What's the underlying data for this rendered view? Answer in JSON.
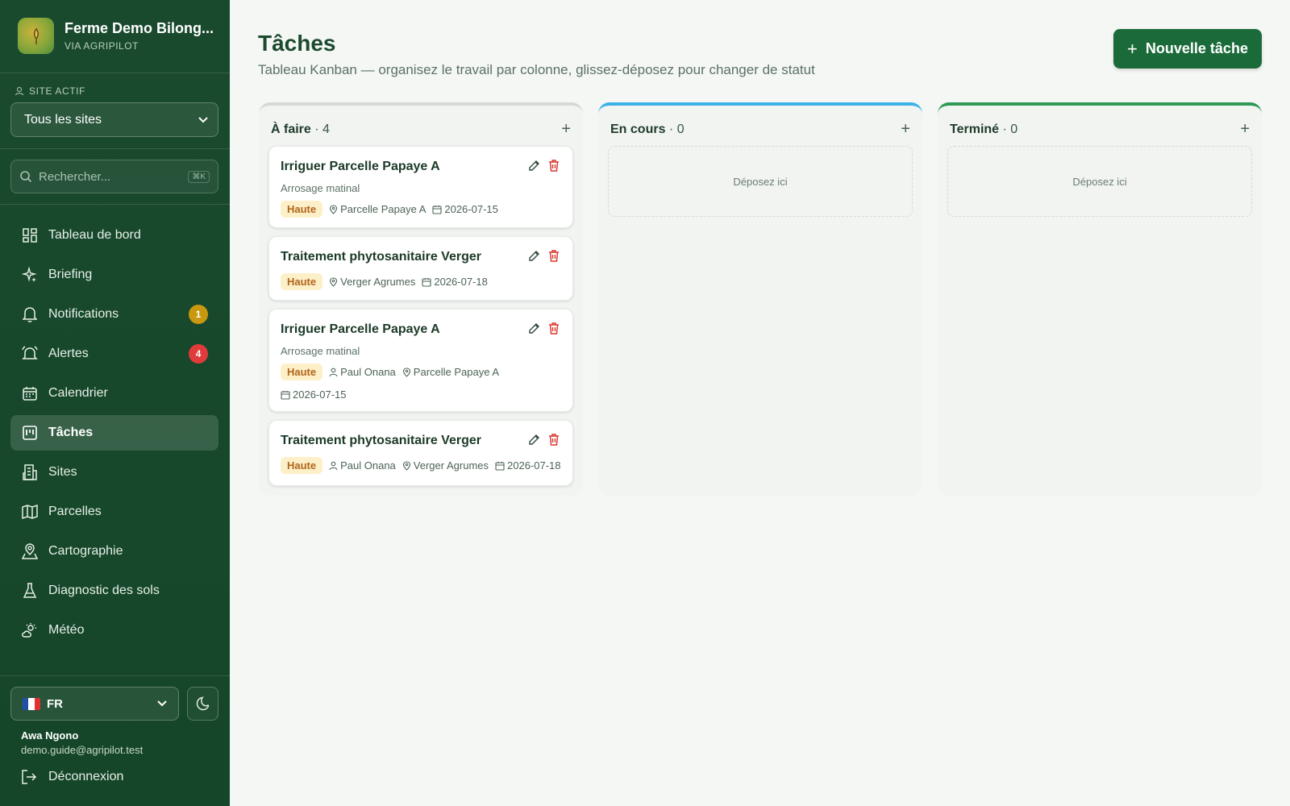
{
  "sidebar": {
    "brand_title": "Ferme Demo Bilong...",
    "brand_sub": "VIA AGRIPILOT",
    "site_label": "SITE ACTIF",
    "site_value": "Tous les sites",
    "search_placeholder": "Rechercher...",
    "search_shortcut": "⌘K",
    "items": [
      {
        "label": "Tableau de bord",
        "icon": "dashboard-icon"
      },
      {
        "label": "Briefing",
        "icon": "sparkles-icon"
      },
      {
        "label": "Notifications",
        "icon": "bell-icon",
        "badge": "1",
        "badge_color": "#c9980f"
      },
      {
        "label": "Alertes",
        "icon": "alarm-bell-icon",
        "badge": "4",
        "badge_color": "#e03b3b"
      },
      {
        "label": "Calendrier",
        "icon": "calendar-icon"
      },
      {
        "label": "Tâches",
        "icon": "kanban-icon",
        "active": true
      },
      {
        "label": "Sites",
        "icon": "building-icon"
      },
      {
        "label": "Parcelles",
        "icon": "map-icon"
      },
      {
        "label": "Cartographie",
        "icon": "map-pin-icon"
      },
      {
        "label": "Diagnostic des sols",
        "icon": "flask-icon"
      },
      {
        "label": "Météo",
        "icon": "cloud-sun-icon"
      }
    ],
    "language": "FR",
    "user_name": "Awa Ngono",
    "user_email": "demo.guide@agripilot.test",
    "logout_label": "Déconnexion"
  },
  "header": {
    "title": "Tâches",
    "subtitle": "Tableau Kanban — organisez le travail par colonne, glissez-déposez pour changer de statut",
    "new_task_label": "Nouvelle tâche"
  },
  "columns": [
    {
      "name": "À faire",
      "count": "· 4",
      "accent": "#d3dad5"
    },
    {
      "name": "En cours",
      "count": "· 0",
      "accent": "#3bb3e8",
      "drop_label": "Déposez ici"
    },
    {
      "name": "Terminé",
      "count": "· 0",
      "accent": "#2e9a55",
      "drop_label": "Déposez ici"
    }
  ],
  "tasks": [
    {
      "title": "Irriguer Parcelle Papaye A",
      "desc": "Arrosage matinal",
      "priority": "Haute",
      "location": "Parcelle Papaye A",
      "date": "2026-07-15"
    },
    {
      "title": "Traitement phytosanitaire Verger",
      "priority": "Haute",
      "location": "Verger Agrumes",
      "date": "2026-07-18"
    },
    {
      "title": "Irriguer Parcelle Papaye A",
      "desc": "Arrosage matinal",
      "priority": "Haute",
      "assignee": "Paul Onana",
      "location": "Parcelle Papaye A",
      "date": "2026-07-15"
    },
    {
      "title": "Traitement phytosanitaire Verger",
      "priority": "Haute",
      "assignee": "Paul Onana",
      "location": "Verger Agrumes",
      "date": "2026-07-18"
    }
  ],
  "colors": {
    "sidebar": "#1a4a2e",
    "primary": "#1b6b3a",
    "priority_bg": "#fdf0c8",
    "priority_text": "#b0651a",
    "delete": "#d9342b"
  }
}
